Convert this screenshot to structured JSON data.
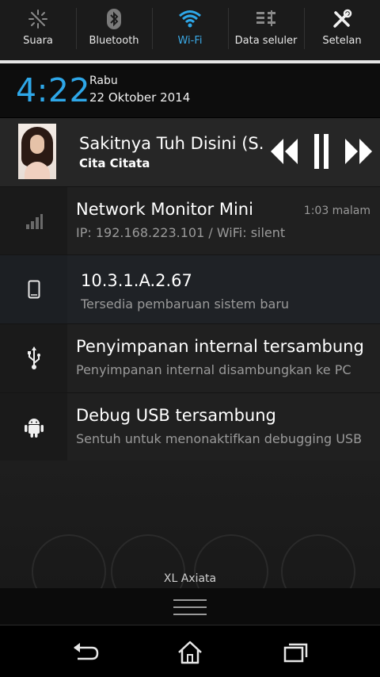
{
  "quick_settings": [
    {
      "label": "Suara",
      "icon": "sound-off-icon",
      "active": false
    },
    {
      "label": "Bluetooth",
      "icon": "bluetooth-icon",
      "active": false
    },
    {
      "label": "Wi-Fi",
      "icon": "wifi-icon",
      "active": true
    },
    {
      "label": "Data seluler",
      "icon": "mobile-data-icon",
      "active": false
    },
    {
      "label": "Setelan",
      "icon": "settings-tools-icon",
      "active": false
    }
  ],
  "clock": {
    "time": "4:22",
    "day": "Rabu",
    "date": "22 Oktober 2014"
  },
  "media": {
    "title": "Sakitnya Tuh Disini (S...",
    "artist": "Cita Citata"
  },
  "notifications": [
    {
      "title": "Network Monitor Mini",
      "subtitle": "IP: 192.168.223.101 / WiFi: silent",
      "time": "1:03 malam",
      "icon": "signal-bars-icon"
    },
    {
      "title": "10.3.1.A.2.67",
      "subtitle": "Tersedia pembaruan sistem baru",
      "icon": "phone-update-icon"
    },
    {
      "title": "Penyimpanan internal tersambung",
      "subtitle": "Penyimpanan internal disambungkan ke PC",
      "icon": "usb-icon"
    },
    {
      "title": "Debug USB tersambung",
      "subtitle": "Sentuh untuk menonaktifkan debugging USB",
      "icon": "android-icon"
    }
  ],
  "carrier": "XL Axiata",
  "colors": {
    "accent": "#2ea7e8",
    "background": "#000000",
    "panel": "#202020"
  }
}
